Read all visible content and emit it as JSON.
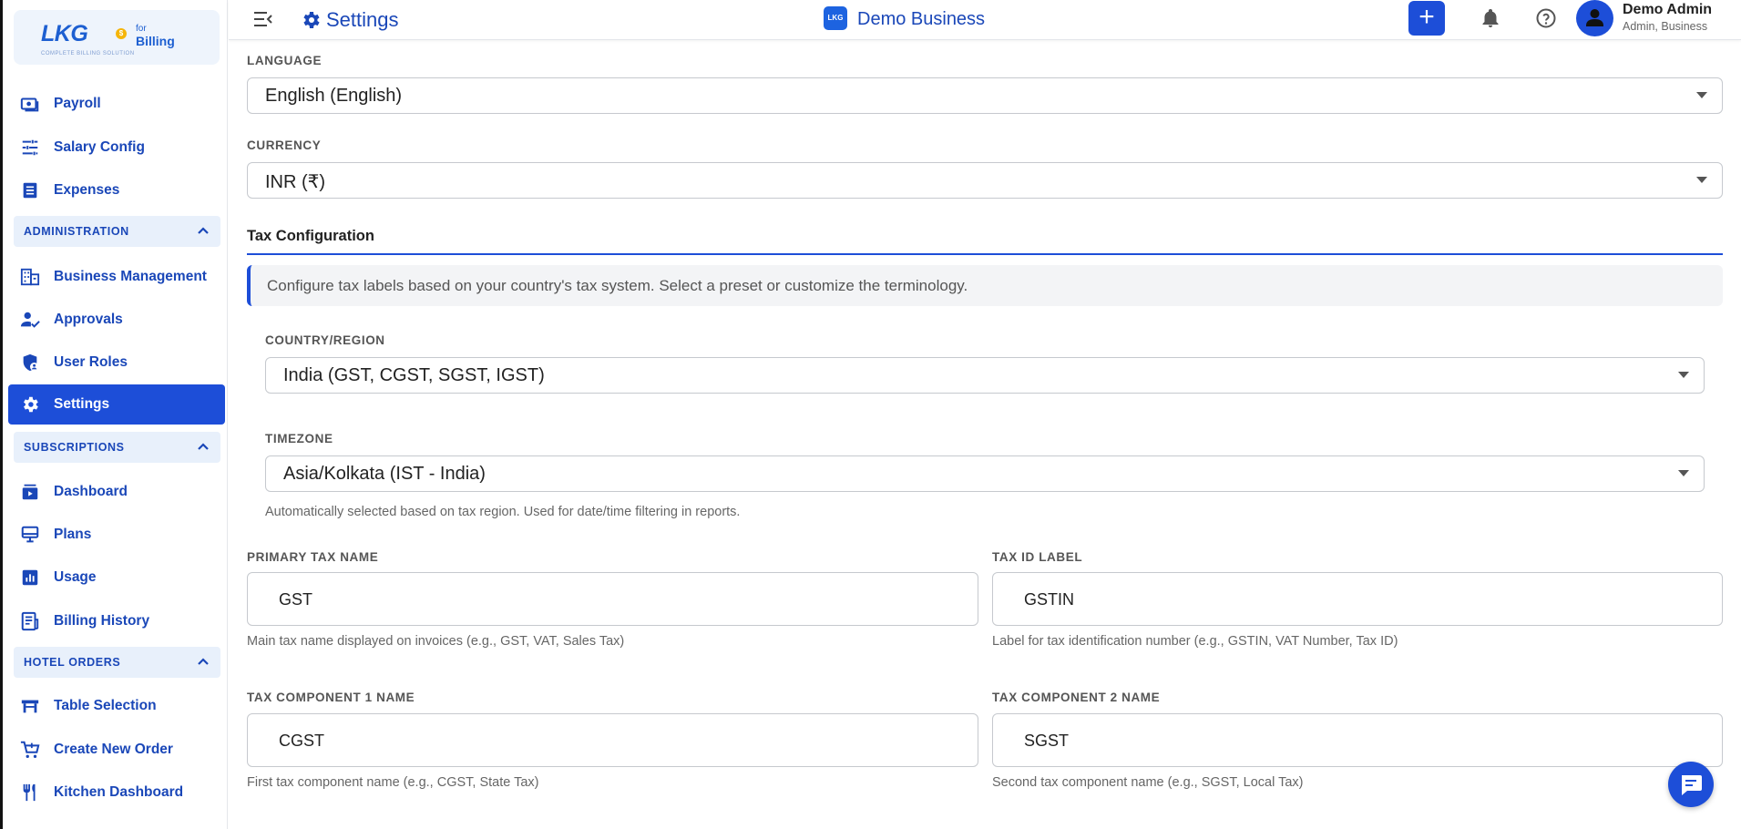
{
  "logo": {
    "brand": "LKG",
    "for": "for",
    "product": "Billing",
    "tagline": "COMPLETE BILLING SOLUTION",
    "coin": "$"
  },
  "sidebar": {
    "items_top": [
      {
        "label": "Payroll",
        "icon": "payroll-icon"
      },
      {
        "label": "Salary Config",
        "icon": "tune-icon"
      },
      {
        "label": "Expenses",
        "icon": "receipt-icon"
      }
    ],
    "sections": [
      {
        "title": "ADMINISTRATION",
        "items": [
          {
            "label": "Business Management",
            "icon": "building-icon"
          },
          {
            "label": "Approvals",
            "icon": "person-check-icon"
          },
          {
            "label": "User Roles",
            "icon": "shield-user-icon"
          },
          {
            "label": "Settings",
            "icon": "gear-icon",
            "active": true
          }
        ]
      },
      {
        "title": "SUBSCRIPTIONS",
        "items": [
          {
            "label": "Dashboard",
            "icon": "subscriptions-icon"
          },
          {
            "label": "Plans",
            "icon": "plans-icon"
          },
          {
            "label": "Usage",
            "icon": "bar-chart-icon"
          },
          {
            "label": "Billing History",
            "icon": "receipt-long-icon"
          }
        ]
      },
      {
        "title": "HOTEL ORDERS",
        "items": [
          {
            "label": "Table Selection",
            "icon": "table-icon"
          },
          {
            "label": "Create New Order",
            "icon": "cart-add-icon"
          },
          {
            "label": "Kitchen Dashboard",
            "icon": "restaurant-icon"
          }
        ]
      }
    ]
  },
  "topbar": {
    "title": "Settings",
    "business_icon_text": "LKG",
    "business_name": "Demo Business",
    "add_label": "+",
    "user_name": "Demo Admin",
    "user_role": "Admin, Business"
  },
  "main": {
    "language": {
      "label": "LANGUAGE",
      "value": "English (English)"
    },
    "currency": {
      "label": "CURRENCY",
      "value": "INR (₹)"
    },
    "tax_configuration": {
      "heading": "Tax Configuration",
      "info": "Configure tax labels based on your country's tax system. Select a preset or customize the terminology.",
      "country": {
        "label": "COUNTRY/REGION",
        "value": "India (GST, CGST, SGST, IGST)"
      },
      "timezone": {
        "label": "TIMEZONE",
        "value": "Asia/Kolkata (IST - India)",
        "help": "Automatically selected based on tax region. Used for date/time filtering in reports."
      },
      "primary_tax": {
        "label": "PRIMARY TAX NAME",
        "value": "GST",
        "help": "Main tax name displayed on invoices (e.g., GST, VAT, Sales Tax)"
      },
      "tax_id": {
        "label": "TAX ID LABEL",
        "value": "GSTIN",
        "help": "Label for tax identification number (e.g., GSTIN, VAT Number, Tax ID)"
      },
      "component1": {
        "label": "TAX COMPONENT 1 NAME",
        "value": "CGST",
        "help": "First tax component name (e.g., CGST, State Tax)"
      },
      "component2": {
        "label": "TAX COMPONENT 2 NAME",
        "value": "SGST",
        "help": "Second tax component name (e.g., SGST, Local Tax)"
      }
    }
  },
  "colors": {
    "accent": "#1d4ed8",
    "nav_text": "#1a47b8",
    "section_bg": "#e8f0fb"
  }
}
